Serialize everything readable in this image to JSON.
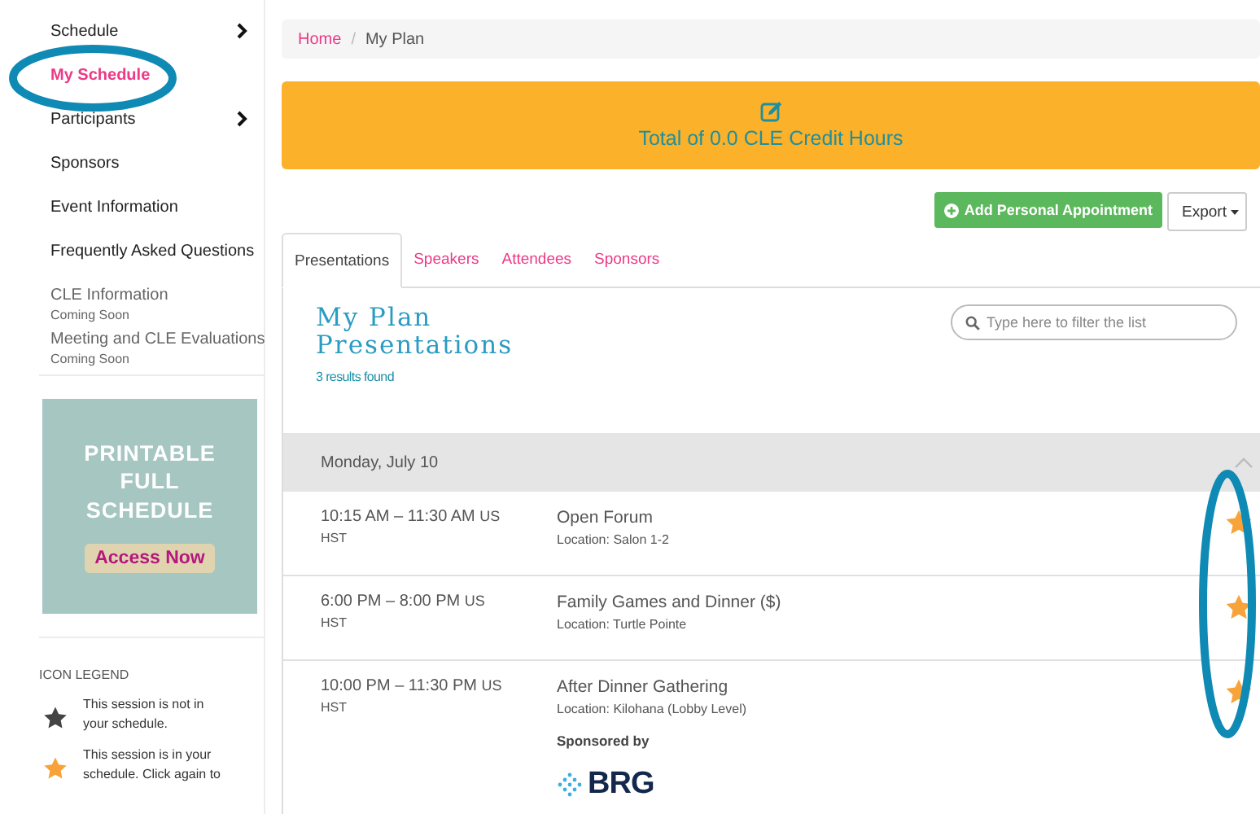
{
  "sidebar": {
    "items": [
      {
        "label": "Schedule",
        "selected": false,
        "has_submenu": true,
        "circled": false
      },
      {
        "label": "My Schedule",
        "selected": true,
        "has_submenu": false,
        "circled": true
      },
      {
        "label": "Participants",
        "selected": false,
        "has_submenu": true,
        "circled": false
      },
      {
        "label": "Sponsors",
        "selected": false,
        "has_submenu": false,
        "circled": false
      },
      {
        "label": "Event Information",
        "selected": false,
        "has_submenu": false,
        "circled": false
      },
      {
        "label": "Frequently Asked Questions",
        "selected": false,
        "has_submenu": false,
        "circled": false
      },
      {
        "label": "CLE Information",
        "note": "Coming Soon",
        "selected": false,
        "has_submenu": false,
        "circled": false
      },
      {
        "label": "Meeting and CLE Evaluations",
        "note": "Coming Soon",
        "selected": false,
        "has_submenu": false,
        "circled": false
      }
    ],
    "promo": {
      "lines": [
        "PRINTABLE",
        "FULL",
        "SCHEDULE"
      ],
      "button": "Access Now"
    },
    "legend": {
      "title": "ICON LEGEND",
      "items": [
        {
          "in_schedule": false,
          "text": "This session is not in your schedule."
        },
        {
          "in_schedule": true,
          "text": "This session is in your schedule. Click again to"
        }
      ]
    }
  },
  "breadcrumb": [
    {
      "label": "Home",
      "kind": "link"
    },
    {
      "label": "/",
      "kind": "separator"
    },
    {
      "label": "My Plan",
      "kind": "current"
    }
  ],
  "credit_banner": {
    "text": "Total of 0.0 CLE Credit Hours"
  },
  "actions": {
    "add": "Add Personal Appointment",
    "export": "Export"
  },
  "tabs": [
    {
      "label": "Presentations",
      "selected": true
    },
    {
      "label": "Speakers",
      "selected": false
    },
    {
      "label": "Attendees",
      "selected": false
    },
    {
      "label": "Sponsors",
      "selected": false
    }
  ],
  "plan": {
    "title_lines": [
      "My Plan",
      "Presentations"
    ],
    "results": "3 results found",
    "filter": {
      "placeholder": "Type here to filter the list"
    },
    "day": {
      "label": "Monday, July 10",
      "expanded": true
    },
    "stars_circled": true,
    "sessions": [
      {
        "time": "10:15 AM – 11:30 AM",
        "tz": "US",
        "tz2": "HST",
        "title": "Open Forum",
        "location": "Location: Salon 1-2",
        "in_schedule": true
      },
      {
        "time": "6:00 PM – 8:00 PM",
        "tz": "US",
        "tz2": "HST",
        "title": "Family Games and Dinner ($)",
        "location": "Location: Turtle Pointe",
        "in_schedule": true
      },
      {
        "time": "10:00 PM – 11:30 PM",
        "tz": "US",
        "tz2": "HST",
        "title": "After Dinner Gathering",
        "location": "Location: Kilohana (Lobby Level)",
        "in_schedule": true,
        "sponsor_label": "Sponsored by",
        "sponsor_logo": "BRG"
      }
    ]
  }
}
